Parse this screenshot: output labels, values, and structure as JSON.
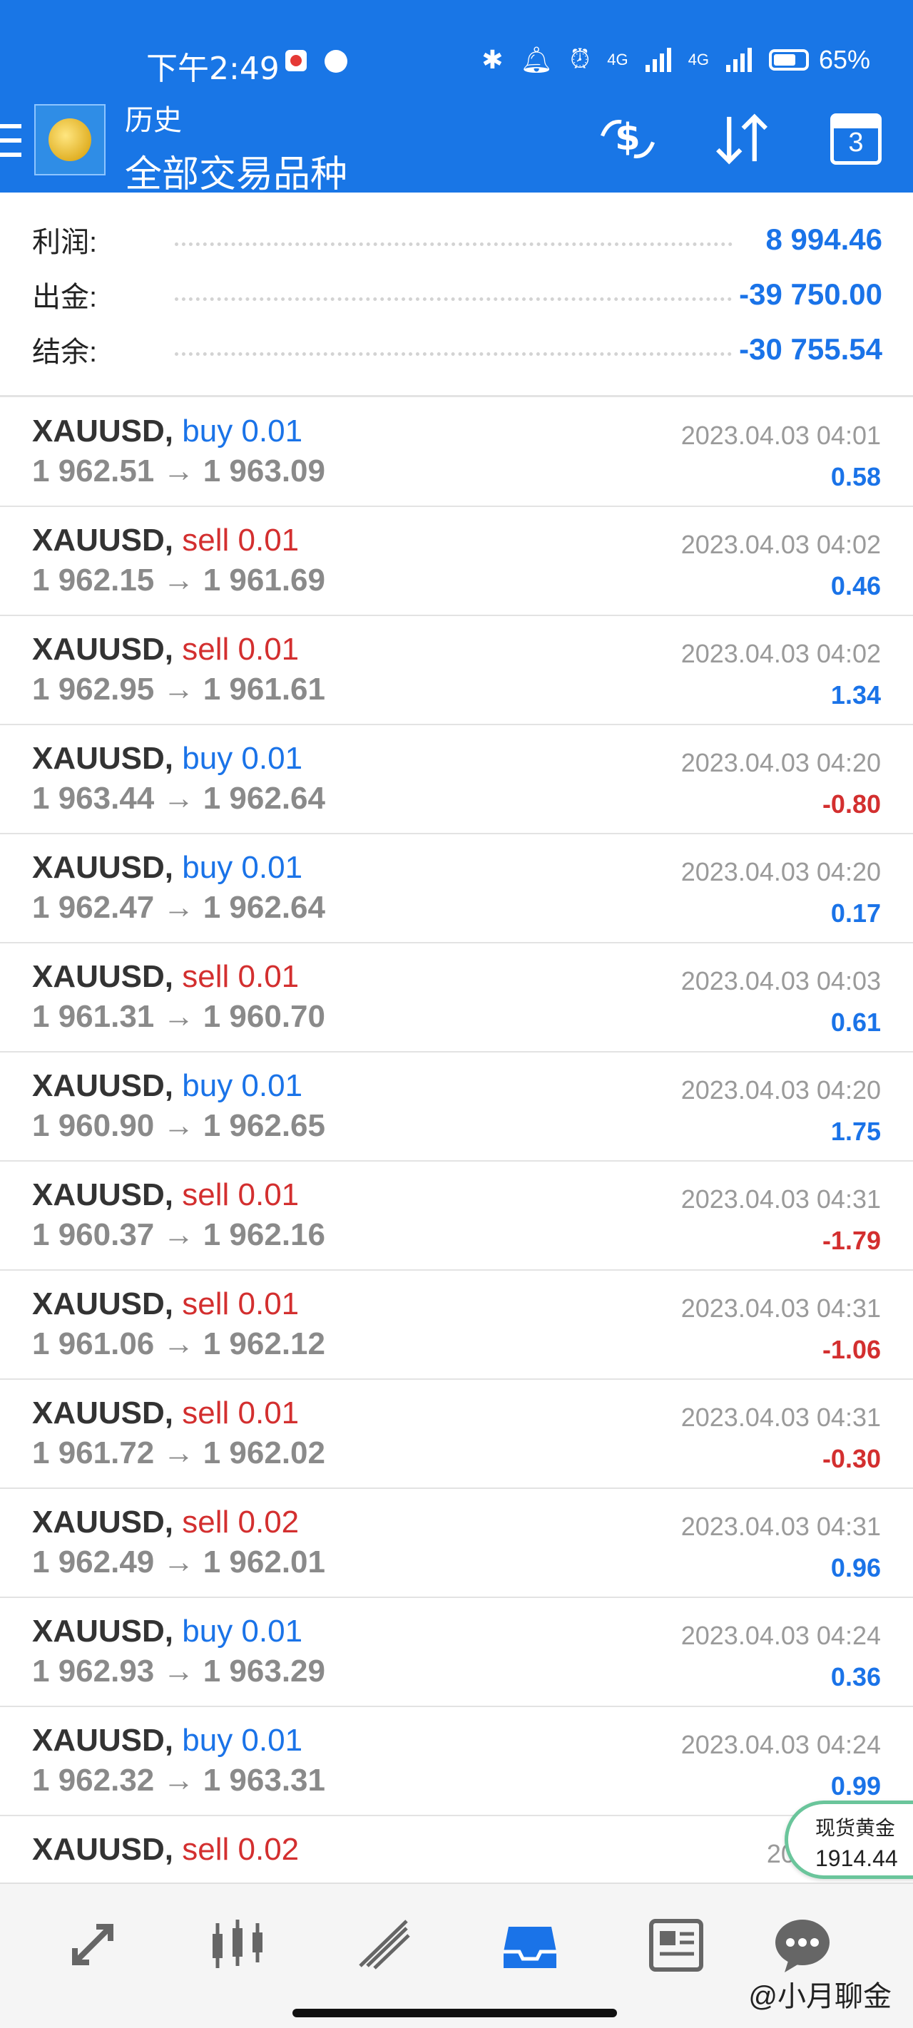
{
  "status_bar": {
    "time": "下午2:49",
    "network_1": "4G",
    "network_2": "4G",
    "battery": "65%"
  },
  "app_bar": {
    "title": "历史",
    "subtitle": "全部交易品种",
    "calendar_badge": "3"
  },
  "summary": {
    "profit_label": "利润:",
    "profit_value": "8 994.46",
    "withdraw_label": "出金:",
    "withdraw_value": "-39 750.00",
    "balance_label": "结余:",
    "balance_value": "-30 755.54"
  },
  "trades": [
    {
      "symbol": "XAUUSD,",
      "side": "buy 0.01",
      "type": "buy",
      "prices": "1 962.51 → 1 963.09",
      "time": "2023.04.03 04:01",
      "profit": "0.58",
      "profit_sign": "pos"
    },
    {
      "symbol": "XAUUSD,",
      "side": "sell 0.01",
      "type": "sell",
      "prices": "1 962.15 → 1 961.69",
      "time": "2023.04.03 04:02",
      "profit": "0.46",
      "profit_sign": "pos"
    },
    {
      "symbol": "XAUUSD,",
      "side": "sell 0.01",
      "type": "sell",
      "prices": "1 962.95 → 1 961.61",
      "time": "2023.04.03 04:02",
      "profit": "1.34",
      "profit_sign": "pos"
    },
    {
      "symbol": "XAUUSD,",
      "side": "buy 0.01",
      "type": "buy",
      "prices": "1 963.44 → 1 962.64",
      "time": "2023.04.03 04:20",
      "profit": "-0.80",
      "profit_sign": "neg"
    },
    {
      "symbol": "XAUUSD,",
      "side": "buy 0.01",
      "type": "buy",
      "prices": "1 962.47 → 1 962.64",
      "time": "2023.04.03 04:20",
      "profit": "0.17",
      "profit_sign": "pos"
    },
    {
      "symbol": "XAUUSD,",
      "side": "sell 0.01",
      "type": "sell",
      "prices": "1 961.31 → 1 960.70",
      "time": "2023.04.03 04:03",
      "profit": "0.61",
      "profit_sign": "pos"
    },
    {
      "symbol": "XAUUSD,",
      "side": "buy 0.01",
      "type": "buy",
      "prices": "1 960.90 → 1 962.65",
      "time": "2023.04.03 04:20",
      "profit": "1.75",
      "profit_sign": "pos"
    },
    {
      "symbol": "XAUUSD,",
      "side": "sell 0.01",
      "type": "sell",
      "prices": "1 960.37 → 1 962.16",
      "time": "2023.04.03 04:31",
      "profit": "-1.79",
      "profit_sign": "neg"
    },
    {
      "symbol": "XAUUSD,",
      "side": "sell 0.01",
      "type": "sell",
      "prices": "1 961.06 → 1 962.12",
      "time": "2023.04.03 04:31",
      "profit": "-1.06",
      "profit_sign": "neg"
    },
    {
      "symbol": "XAUUSD,",
      "side": "sell 0.01",
      "type": "sell",
      "prices": "1 961.72 → 1 962.02",
      "time": "2023.04.03 04:31",
      "profit": "-0.30",
      "profit_sign": "neg"
    },
    {
      "symbol": "XAUUSD,",
      "side": "sell 0.02",
      "type": "sell",
      "prices": "1 962.49 → 1 962.01",
      "time": "2023.04.03 04:31",
      "profit": "0.96",
      "profit_sign": "pos"
    },
    {
      "symbol": "XAUUSD,",
      "side": "buy 0.01",
      "type": "buy",
      "prices": "1 962.93 → 1 963.29",
      "time": "2023.04.03 04:24",
      "profit": "0.36",
      "profit_sign": "pos"
    },
    {
      "symbol": "XAUUSD,",
      "side": "buy 0.01",
      "type": "buy",
      "prices": "1 962.32 → 1 963.31",
      "time": "2023.04.03 04:24",
      "profit": "0.99",
      "profit_sign": "pos"
    },
    {
      "symbol": "XAUUSD,",
      "side": "sell 0.02",
      "type": "sell",
      "prices": "",
      "time": "2023.04.0",
      "profit": "",
      "profit_sign": "pos"
    }
  ],
  "ticker": {
    "name": "现货黄金",
    "price": "1914.44"
  },
  "bottom_nav": {
    "items": [
      "quotes-icon",
      "chart-icon",
      "trade-icon",
      "history-icon",
      "news-icon",
      "chat-icon"
    ],
    "active": "history-icon",
    "watermark": "@小月聊金"
  },
  "colors": {
    "header": "#1976e6",
    "positive": "#1a73e8",
    "negative": "#d32f2f",
    "ticker_border": "#6ac59b"
  }
}
